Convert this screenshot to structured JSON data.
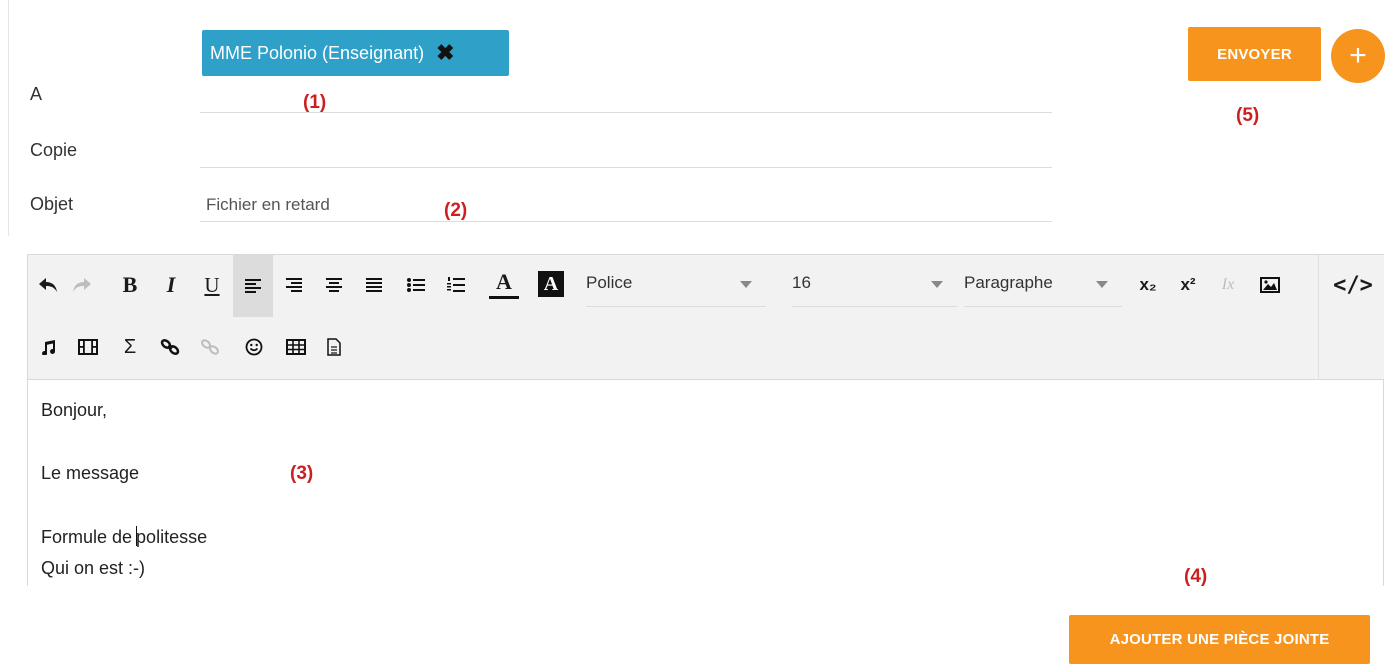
{
  "header": {
    "to_label": "A",
    "cc_label": "Copie",
    "subject_label": "Objet",
    "recipient_chip": "MME Polonio (Enseignant)",
    "subject_value": "Fichier en retard"
  },
  "actions": {
    "send_label": "ENVOYER",
    "add_label": "+",
    "attach_label": "AJOUTER UNE PIÈCE JOINTE"
  },
  "annotations": {
    "a1": "(1)",
    "a2": "(2)",
    "a3": "(3)",
    "a4": "(4)",
    "a5": "(5)"
  },
  "toolbar": {
    "font_select": "Police",
    "size_select": "16",
    "format_select": "Paragraphe",
    "bold": "B",
    "italic": "I",
    "underline": "U",
    "text_color": "A",
    "bg_color": "A",
    "subscript": "x₂",
    "superscript": "x²",
    "remove_format": "Ix",
    "sigma": "Σ",
    "source_code": "</>"
  },
  "body": {
    "line1": "Bonjour,",
    "line2": "Le message",
    "line3_before": "Formule de ",
    "line3_after": "politesse",
    "line4": "Qui on est :-)"
  },
  "colors": {
    "accent_orange": "#f7941e",
    "chip_blue": "#2fa0c8",
    "annotation_red": "#cc1f1f"
  }
}
